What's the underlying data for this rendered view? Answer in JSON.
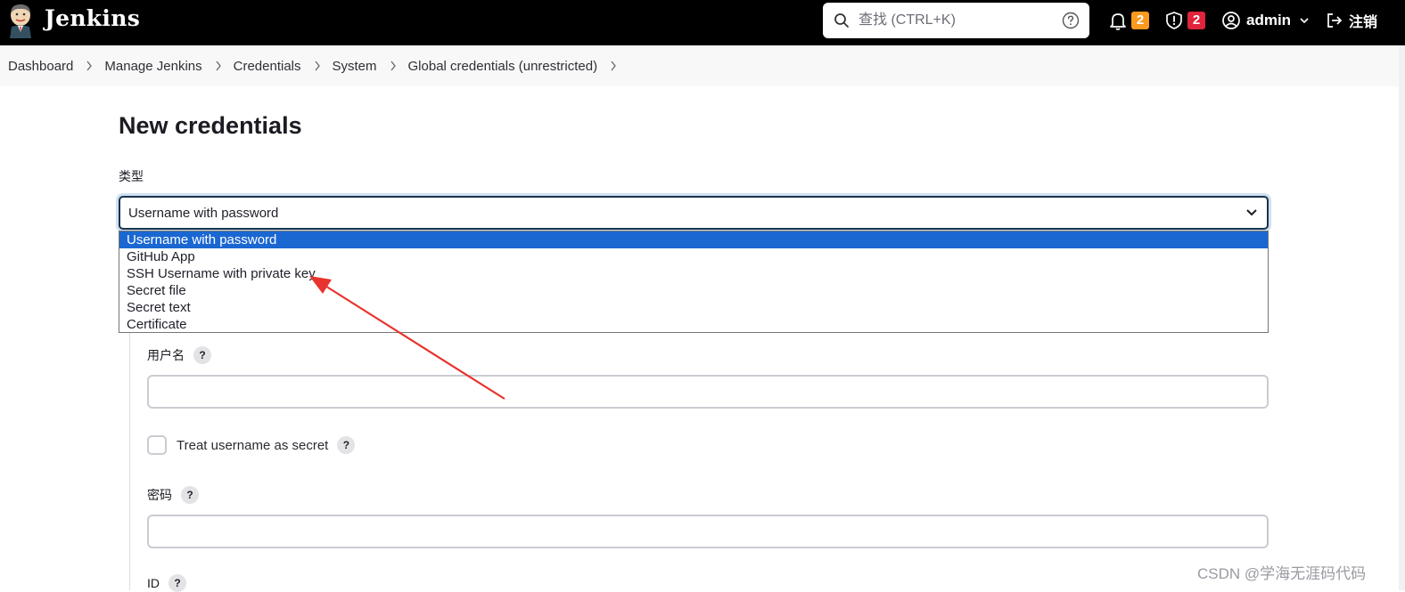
{
  "header": {
    "brand": "Jenkins",
    "search_placeholder": "查找 (CTRL+K)",
    "notifications_count": "2",
    "security_count": "2",
    "user": "admin",
    "logout": "注销"
  },
  "breadcrumb": [
    "Dashboard",
    "Manage Jenkins",
    "Credentials",
    "System",
    "Global credentials (unrestricted)"
  ],
  "main": {
    "title": "New credentials",
    "type_label": "类型",
    "selected_type": "Username with password",
    "options": [
      "Username with password",
      "GitHub App",
      "SSH Username with private key",
      "Secret file",
      "Secret text",
      "Certificate"
    ],
    "username_label": "用户名",
    "treat_username_secret_label": "Treat username as secret",
    "password_label": "密码",
    "id_label": "ID",
    "help_glyph": "?"
  },
  "watermark": "CSDN @学海无涯码代码",
  "colors": {
    "header_bg": "#000000",
    "selected_option": "#1a67d2",
    "notification_badge": "#fb9a1e",
    "security_badge": "#e0243c",
    "annotation_arrow": "#e8332e"
  },
  "icons": [
    "jenkins-logo-icon",
    "search-icon",
    "help-circle-icon",
    "bell-icon",
    "shield-icon",
    "user-circle-icon",
    "chevron-down-icon",
    "logout-icon",
    "chevron-right-icon"
  ]
}
